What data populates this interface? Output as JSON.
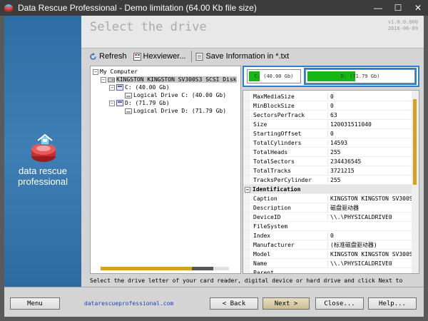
{
  "window": {
    "title": "Data Rescue Professional - Demo limitation (64.00 Kb file size)",
    "minimize_glyph": "—",
    "maximize_glyph": "☐",
    "close_glyph": "✕"
  },
  "brand": {
    "line1": "data rescue",
    "line2": "professional"
  },
  "header": {
    "title": "Select the drive",
    "version_line1": "v1.0.0.000",
    "version_line2": "2016-06-09"
  },
  "toolbar": {
    "refresh": "Refresh",
    "hexviewer": "Hexviewer...",
    "save_info": "Save Information in *.txt"
  },
  "tree": {
    "root": "My Computer",
    "disk": "KINGSTON KINGSTON SV300S3 SCSI Disk",
    "drive_c": "C: (40.00 Gb)",
    "logical_c": "Logical Drive C: (40.00 Gb)",
    "drive_d": "D: (71.79 Gb)",
    "logical_d": "Logical Drive D: (71.79 Gb)",
    "collapse_glyph": "−"
  },
  "partitions": [
    {
      "label": "C: (40.00 Gb)",
      "fill_fraction": 0.22
    },
    {
      "label": "D: (71.79 Gb)",
      "fill_fraction": 0.45
    }
  ],
  "properties": {
    "rows": [
      {
        "key": "MaxMediaSize",
        "value": "0"
      },
      {
        "key": "MinBlockSize",
        "value": "0"
      },
      {
        "key": "SectorsPerTrack",
        "value": "63"
      },
      {
        "key": "Size",
        "value": "120031511040"
      },
      {
        "key": "StartingOffset",
        "value": "0"
      },
      {
        "key": "TotalCylinders",
        "value": "14593"
      },
      {
        "key": "TotalHeads",
        "value": "255"
      },
      {
        "key": "TotalSectors",
        "value": "234436545"
      },
      {
        "key": "TotalTracks",
        "value": "3721215"
      },
      {
        "key": "TracksPerCylinder",
        "value": "255"
      },
      {
        "key": "Identification",
        "value": "",
        "category": true
      },
      {
        "key": "Caption",
        "value": "KINGSTON KINGSTON SV300S3"
      },
      {
        "key": "Description",
        "value": "磁盘驱动器"
      },
      {
        "key": "DeviceID",
        "value": "\\\\.\\PHYSICALDRIVE0"
      },
      {
        "key": "FileSystem",
        "value": ""
      },
      {
        "key": "Index",
        "value": "0"
      },
      {
        "key": "Manufacturer",
        "value": "(标准磁盘驱动器)"
      },
      {
        "key": "Model",
        "value": "KINGSTON KINGSTON SV300S3"
      },
      {
        "key": "Name",
        "value": "\\\\.\\PHYSICALDRIVE0"
      },
      {
        "key": "Parent",
        "value": ""
      }
    ],
    "category_glyph": "−"
  },
  "hint": "Select the drive letter of your card reader, digital device or hard drive and click Next to",
  "footer": {
    "menu": "Menu",
    "site": "datarescueprofessional.com",
    "back": "< Back",
    "next": "Next >",
    "close": "Close...",
    "help": "Help..."
  },
  "colors": {
    "accent": "#2a7fd0",
    "partition_fill": "#14b814",
    "brand_panel": "#2e6da5"
  }
}
